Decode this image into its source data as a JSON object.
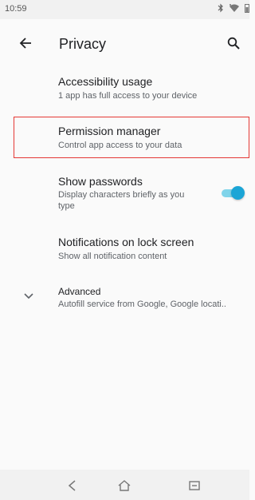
{
  "status_bar": {
    "time": "10:59",
    "icons": [
      "bluetooth-icon",
      "wifi-icon",
      "battery-icon"
    ]
  },
  "app_bar": {
    "title": "Privacy",
    "back_icon": "arrow-back-icon",
    "search_icon": "search-icon"
  },
  "items": [
    {
      "title": "Accessibility usage",
      "subtitle": "1 app has full access to your device"
    },
    {
      "title": "Permission manager",
      "subtitle": "Control app access to your data"
    },
    {
      "title": "Show passwords",
      "subtitle_lines": [
        "Display characters briefly as you",
        "type"
      ],
      "toggle_on": true
    },
    {
      "title": "Notifications on lock screen",
      "subtitle": "Show all notification content"
    },
    {
      "title": "Advanced",
      "subtitle": "Autofill service from Google, Google locati.."
    }
  ],
  "nav_bar": {
    "icons": [
      "back-nav-icon",
      "home-nav-icon",
      "recents-nav-icon"
    ]
  },
  "colors": {
    "accent": "#1ba5d6",
    "highlight_border": "#e53935"
  }
}
